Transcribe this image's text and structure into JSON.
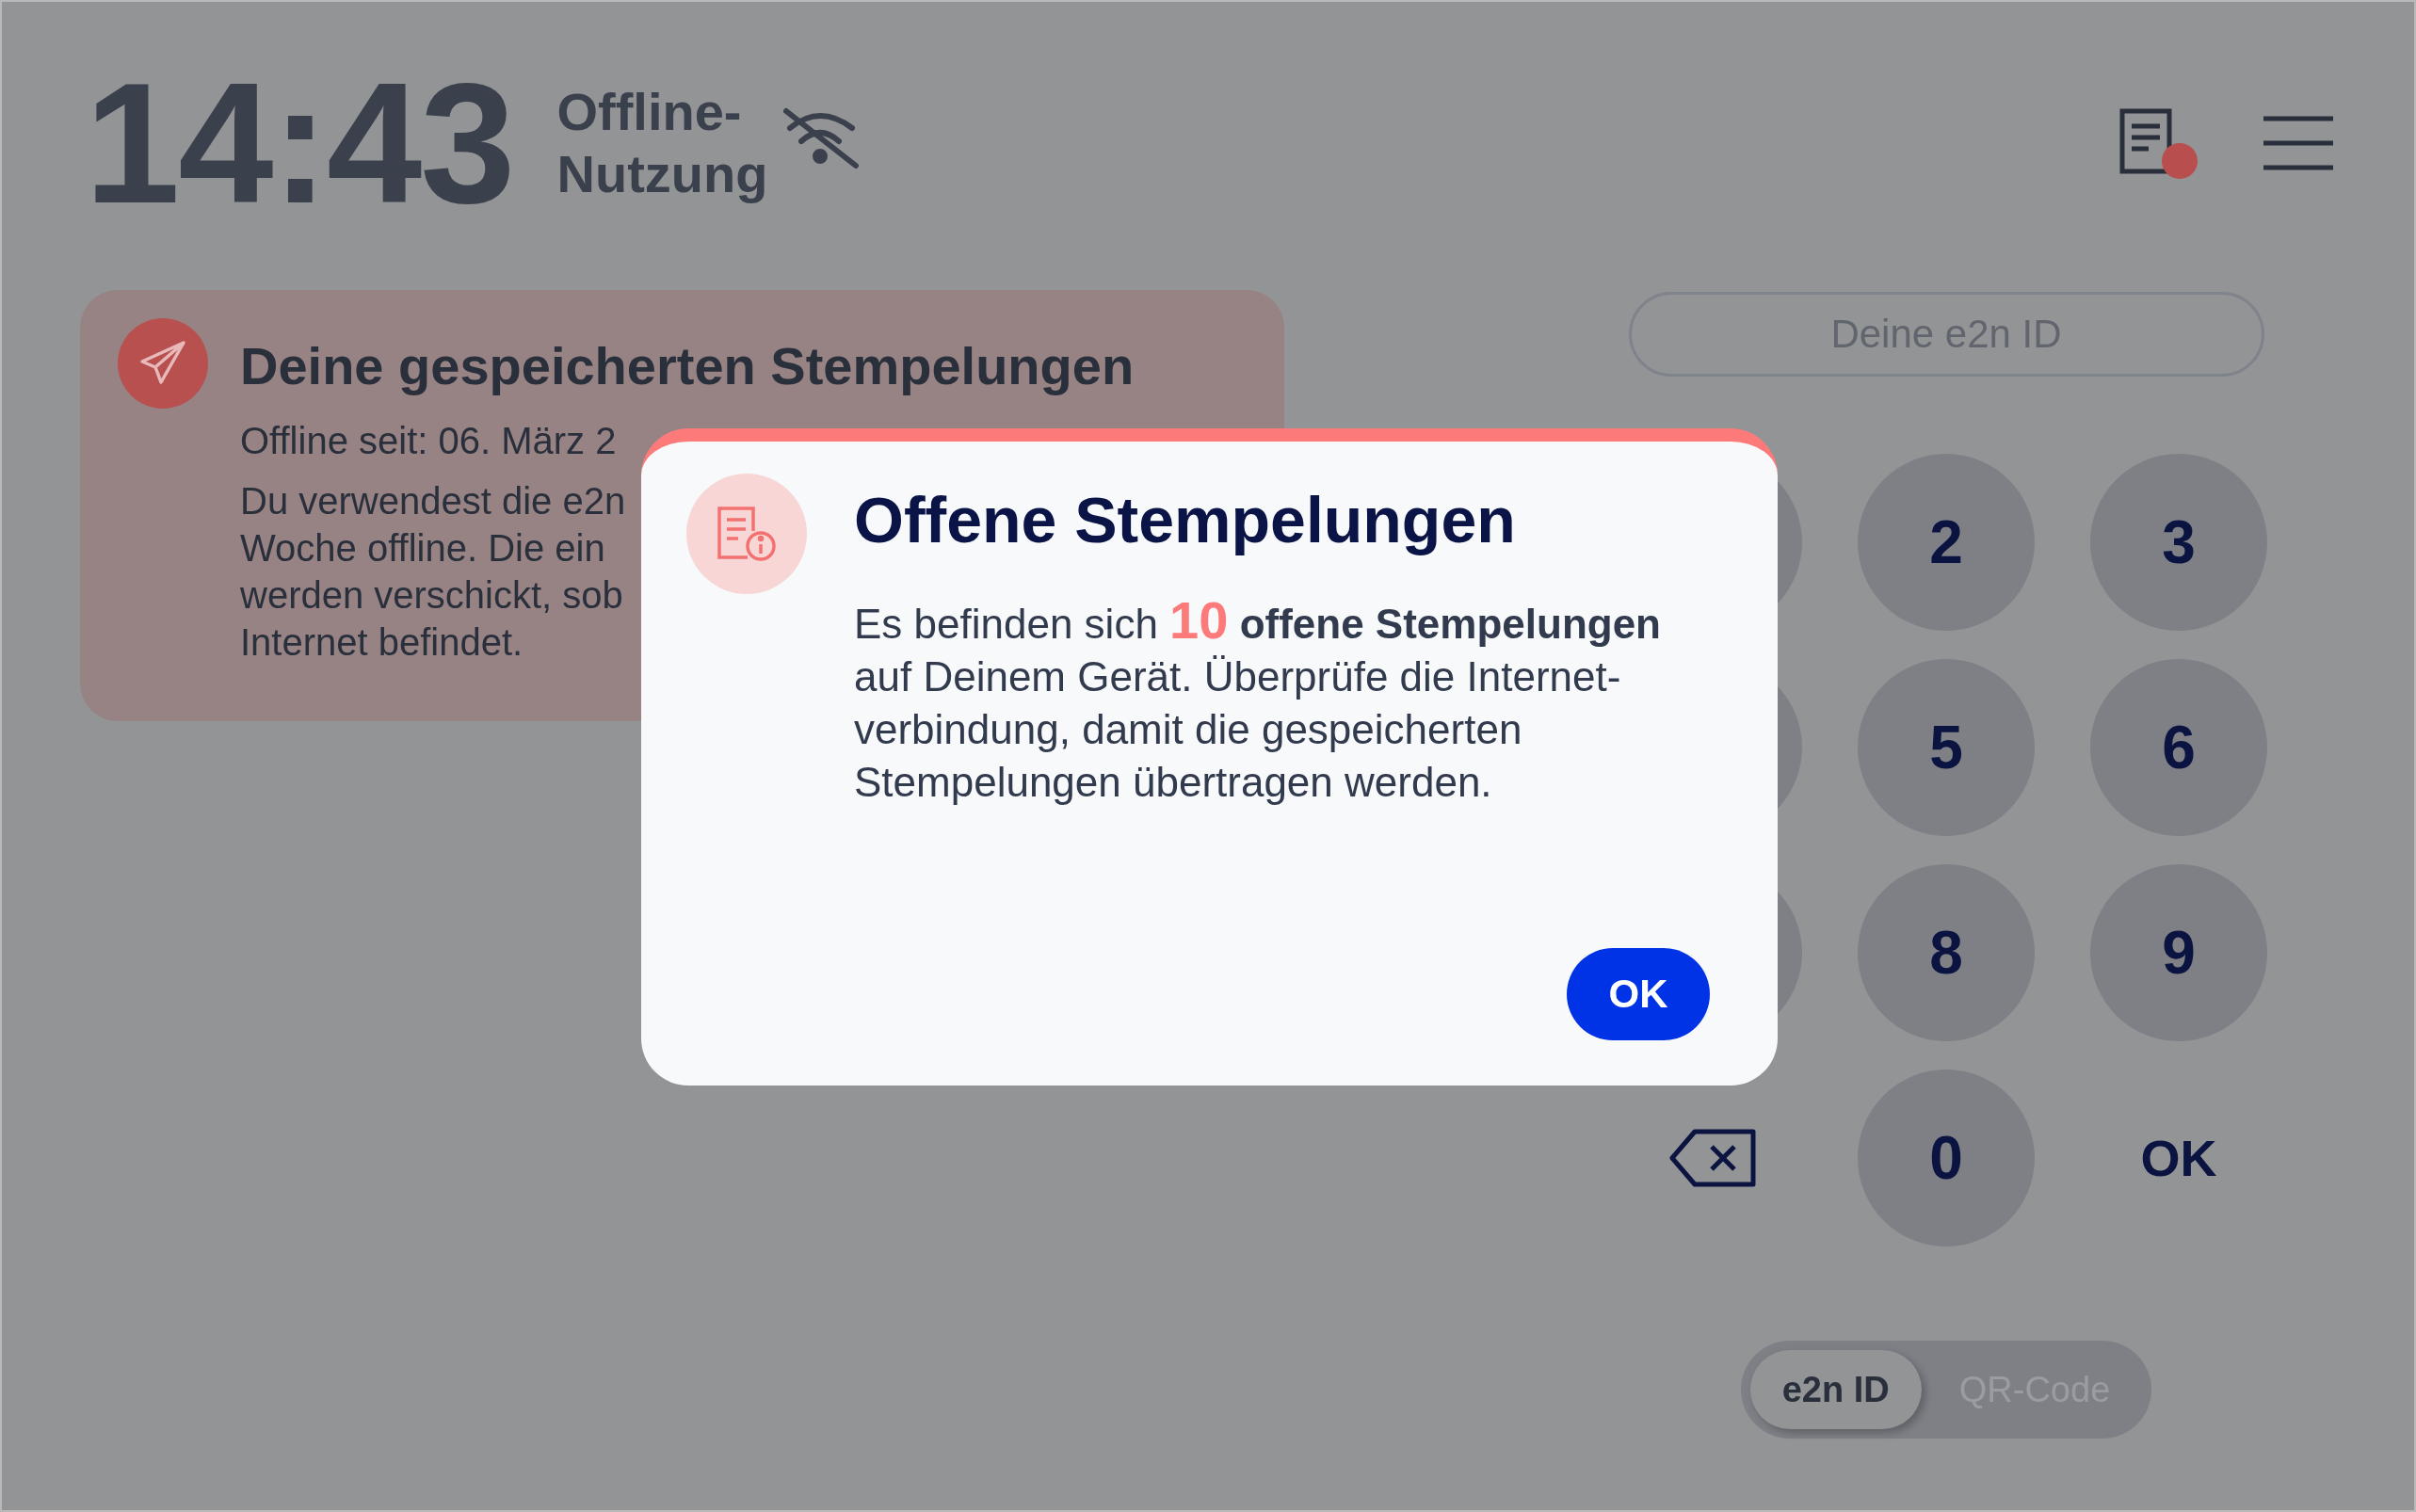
{
  "header": {
    "time": "14:43",
    "status_lines": [
      "Offline-",
      "Nutzung"
    ],
    "notification_dot": true
  },
  "stored_card": {
    "title": "Deine gespeicherten Stempelungen",
    "lines": [
      "Offline seit: 06. März 2",
      "Du verwendest die e2n",
      "Woche offline. Die ein",
      "werden verschickt, sob",
      "Internet befindet."
    ]
  },
  "id_field": {
    "placeholder": "Deine e2n ID"
  },
  "keypad": [
    {
      "kind": "digit"
    },
    {
      "kind": "digit",
      "label": "2"
    },
    {
      "kind": "digit",
      "label": "3"
    },
    {
      "kind": "digit"
    },
    {
      "kind": "digit",
      "label": "5"
    },
    {
      "kind": "digit",
      "label": "6"
    },
    {
      "kind": "digit"
    },
    {
      "kind": "digit",
      "label": "8"
    },
    {
      "kind": "digit",
      "label": "9"
    },
    {
      "kind": "backspace"
    },
    {
      "kind": "digit",
      "label": "0"
    },
    {
      "kind": "text",
      "label": "OK"
    }
  ],
  "mode_toggle": [
    {
      "label": "e2n ID",
      "selected": true
    },
    {
      "label": "QR-Code",
      "selected": false
    }
  ],
  "dialog": {
    "title": "Offene Stempelungen",
    "body": "Es befinden sich **10** **offene Stempelungen** auf Deinem Gerät. Überprüfe die Internet-verbindung, damit die gespeicherten Stempelungen übertragen werden.",
    "button": "OK"
  }
}
